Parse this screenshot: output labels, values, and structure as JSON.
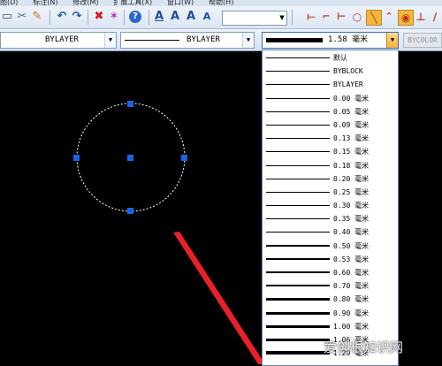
{
  "menubar": {
    "items": [
      "图(D)",
      "标注(N)",
      "修改(M)",
      "扩展工具(X)",
      "窗口(W)",
      "帮助(H)"
    ]
  },
  "toolbar": {
    "icons": [
      "print-icon",
      "cut-icon",
      "match-properties-icon",
      "undo-icon",
      "redo-icon",
      "erase-icon",
      "explode-icon",
      "help-icon",
      "text-style-icon",
      "text-icon",
      "edit-text-icon",
      "text-scale-icon",
      "text-align-icon",
      "line-icon",
      "polyline-icon",
      "dimension-icon",
      "circle-icon",
      "draw-line-icon",
      "angle-icon",
      "snap-center-icon",
      "perpendicular-icon",
      "parallel-icon"
    ]
  },
  "properties": {
    "layer_value": "BYLAYER",
    "linetype_value": "BYLAYER",
    "lineweight_value": "1.58 毫米",
    "color_value": "BYCOLOR"
  },
  "lineweight_options": [
    {
      "label": "默认",
      "weight": 0.25
    },
    {
      "label": "BYBLOCK",
      "weight": 0.25
    },
    {
      "label": "BYLAYER",
      "weight": 0.25
    },
    {
      "label": "0.00 毫米",
      "weight": 0.0
    },
    {
      "label": "0.05 毫米",
      "weight": 0.05
    },
    {
      "label": "0.09 毫米",
      "weight": 0.09
    },
    {
      "label": "0.13 毫米",
      "weight": 0.13
    },
    {
      "label": "0.15 毫米",
      "weight": 0.15
    },
    {
      "label": "0.18 毫米",
      "weight": 0.18
    },
    {
      "label": "0.20 毫米",
      "weight": 0.2
    },
    {
      "label": "0.25 毫米",
      "weight": 0.25
    },
    {
      "label": "0.30 毫米",
      "weight": 0.3
    },
    {
      "label": "0.35 毫米",
      "weight": 0.35
    },
    {
      "label": "0.40 毫米",
      "weight": 0.4
    },
    {
      "label": "0.50 毫米",
      "weight": 0.5
    },
    {
      "label": "0.53 毫米",
      "weight": 0.53
    },
    {
      "label": "0.60 毫米",
      "weight": 0.6
    },
    {
      "label": "0.70 毫米",
      "weight": 0.7
    },
    {
      "label": "0.80 毫米",
      "weight": 0.8
    },
    {
      "label": "0.90 毫米",
      "weight": 0.9
    },
    {
      "label": "1.00 毫米",
      "weight": 1.0
    },
    {
      "label": "1.06 毫米",
      "weight": 1.06
    },
    {
      "label": "1.20 毫米",
      "weight": 1.2
    }
  ],
  "watermark": {
    "text": "爱创根知识网"
  },
  "colors": {
    "accent_arrow": "#e8202a",
    "grip": "#1565e8",
    "dropdown_active": "#f7b33b"
  }
}
